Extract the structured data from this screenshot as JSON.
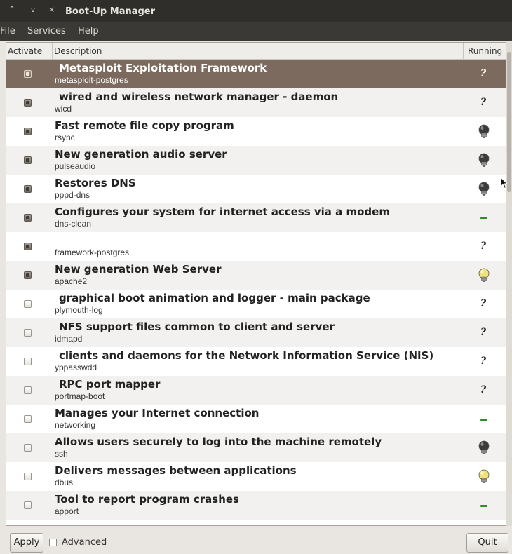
{
  "window": {
    "title": "Boot-Up Manager",
    "controls": [
      "^",
      "v",
      "×"
    ]
  },
  "menu": [
    "File",
    "Services",
    "Help"
  ],
  "columns": {
    "activate": "Activate",
    "description": "Description",
    "running": "Running"
  },
  "rows": [
    {
      "title": "Metasploit Exploitation Framework",
      "subtitle": "metasploit-postgres",
      "active": true,
      "status": "?",
      "selected": true,
      "indent": true
    },
    {
      "title": "wired and wireless network manager - daemon",
      "subtitle": "wicd",
      "active": true,
      "status": "?",
      "indent": true
    },
    {
      "title": "Fast remote file copy program",
      "subtitle": "rsync",
      "active": true,
      "status": "bulb-off-icon"
    },
    {
      "title": "New generation audio server",
      "subtitle": "pulseaudio",
      "active": true,
      "status": "bulb-off-icon"
    },
    {
      "title": "Restores DNS",
      "subtitle": "pppd-dns",
      "active": true,
      "status": "bulb-off-icon"
    },
    {
      "title": "Configures your system for internet access via a modem",
      "subtitle": "dns-clean",
      "active": true,
      "status": "dash-icon"
    },
    {
      "title": "",
      "subtitle": "framework-postgres",
      "active": true,
      "status": "?"
    },
    {
      "title": "New generation Web Server",
      "subtitle": "apache2",
      "active": true,
      "status": "bulb-on-icon"
    },
    {
      "title": "graphical boot animation and logger - main package",
      "subtitle": "plymouth-log",
      "active": false,
      "status": "?",
      "indent": true
    },
    {
      "title": "NFS support files common to client and server",
      "subtitle": "idmapd",
      "active": false,
      "status": "?",
      "indent": true
    },
    {
      "title": "clients and daemons for the Network Information Service (NIS)",
      "subtitle": "yppasswdd",
      "active": false,
      "status": "?",
      "indent": true
    },
    {
      "title": "RPC port mapper",
      "subtitle": "portmap-boot",
      "active": false,
      "status": "?",
      "indent": true
    },
    {
      "title": "Manages your Internet connection",
      "subtitle": "networking",
      "active": false,
      "status": "dash-icon"
    },
    {
      "title": "Allows users securely to log into the machine remotely",
      "subtitle": "ssh",
      "active": false,
      "status": "bulb-off-icon"
    },
    {
      "title": "Delivers messages between applications",
      "subtitle": "dbus",
      "active": false,
      "status": "bulb-on-icon"
    },
    {
      "title": "Tool to report program crashes",
      "subtitle": "apport",
      "active": false,
      "status": "dash-icon"
    }
  ],
  "footer": {
    "apply": "Apply",
    "advanced": "Advanced",
    "quit": "Quit"
  }
}
